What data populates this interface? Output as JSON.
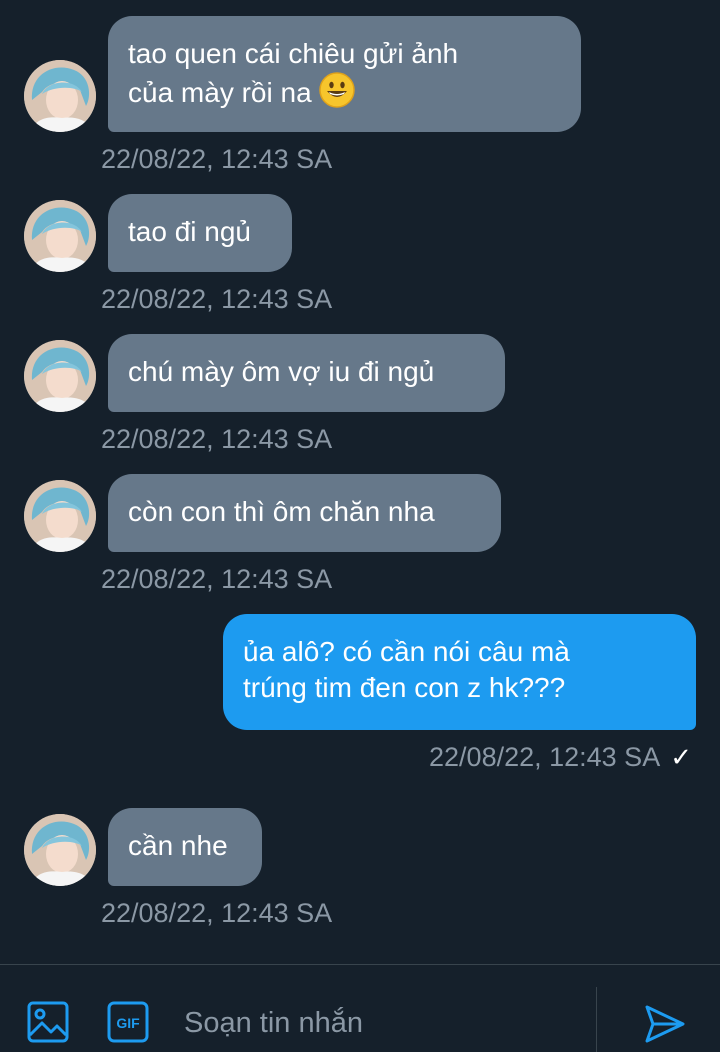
{
  "messages": [
    {
      "direction": "in",
      "text_line1": "tao quen cái chiêu gửi ảnh",
      "text_line2": "của mày rồi na",
      "emoji": "grinning-face",
      "time": "22/08/22, 12:43 SA"
    },
    {
      "direction": "in",
      "text": "tao đi ngủ",
      "time": "22/08/22, 12:43 SA"
    },
    {
      "direction": "in",
      "text": "chú mày ôm vợ iu đi ngủ",
      "time": "22/08/22, 12:43 SA"
    },
    {
      "direction": "in",
      "text": "còn con thì ôm chăn nha",
      "time": "22/08/22, 12:43 SA"
    },
    {
      "direction": "out",
      "text_line1": "ủa alô? có cần nói câu mà",
      "text_line2": "trúng tim đen con z hk???",
      "time": "22/08/22, 12:43 SA",
      "status": "✓"
    },
    {
      "direction": "in",
      "text": "cần nhe",
      "time": "22/08/22, 12:43 SA"
    }
  ],
  "composer": {
    "placeholder": "Soạn tin nhắn",
    "gif_label": "GIF",
    "icons": [
      "image-icon",
      "gif-icon",
      "send-icon"
    ]
  },
  "colors": {
    "background": "#15202b",
    "incoming_bubble": "#66788a",
    "outgoing_bubble": "#1d9bf0",
    "timestamp": "#8b98a5",
    "accent": "#1d9bf0"
  }
}
